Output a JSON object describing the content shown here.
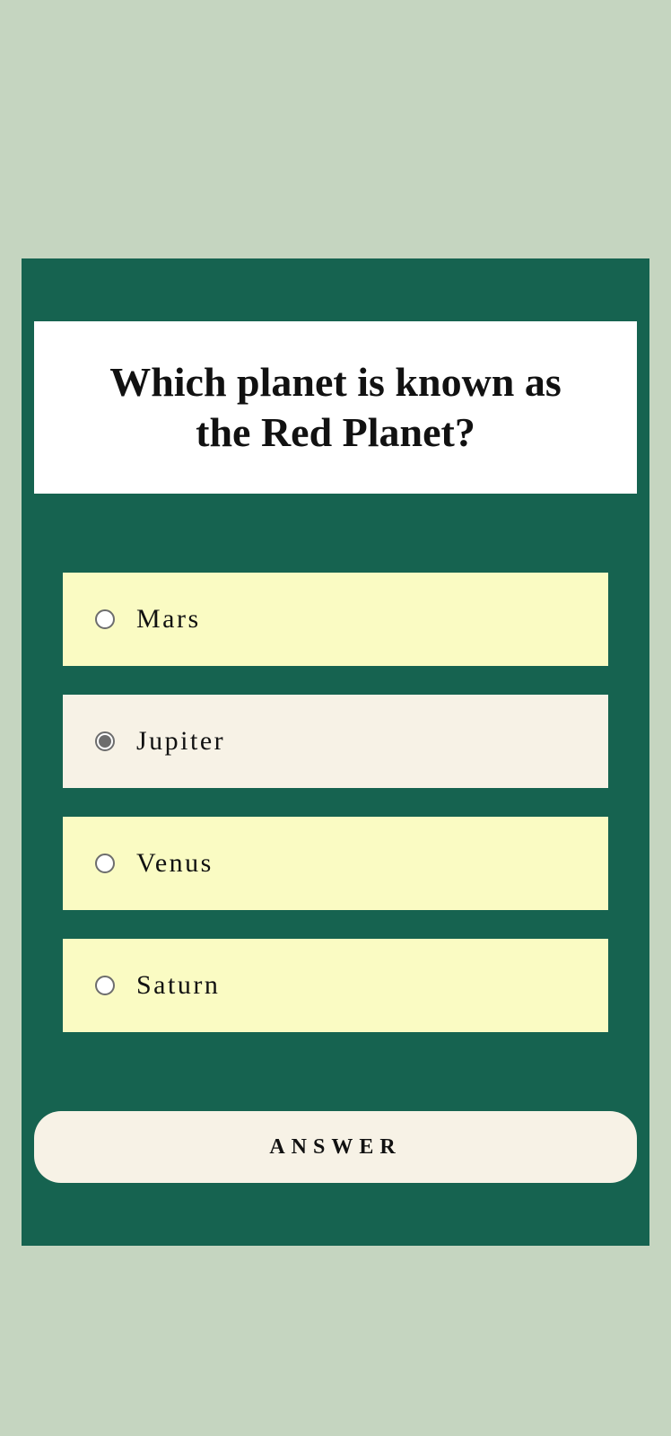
{
  "quiz": {
    "question": "Which planet is known as the Red Planet?",
    "options": [
      {
        "label": "Mars",
        "selected": false
      },
      {
        "label": "Jupiter",
        "selected": true
      },
      {
        "label": "Venus",
        "selected": false
      },
      {
        "label": "Saturn",
        "selected": false
      }
    ],
    "answer_label": "ANSWER"
  },
  "colors": {
    "page_background": "#c5d5c0",
    "card_background": "#166350",
    "question_background": "#ffffff",
    "option_background": "#fafbc3",
    "option_selected_background": "#f7f2e6",
    "button_background": "#f7f2e6",
    "radio_color": "#6d6d6d",
    "text_color": "#111111"
  }
}
